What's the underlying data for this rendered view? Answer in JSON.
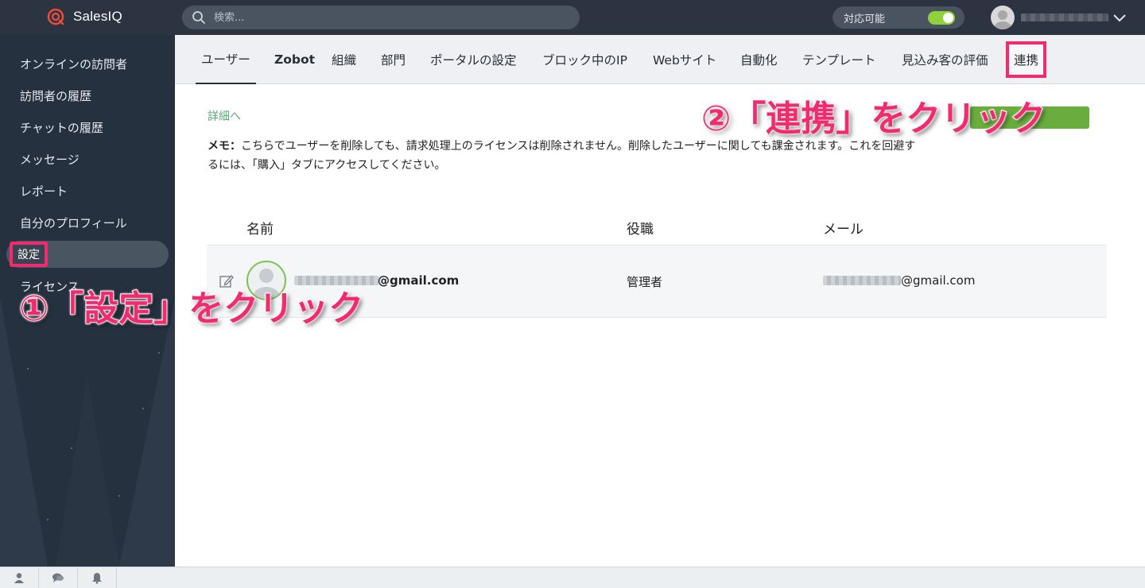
{
  "app": {
    "name": "SalesIQ"
  },
  "search": {
    "placeholder": "検索..."
  },
  "status": {
    "label": "対応可能",
    "toggle_on": true,
    "toggle_color": "#8fd23a"
  },
  "sidebar": {
    "items": [
      {
        "label": "オンラインの訪問者"
      },
      {
        "label": "訪問者の履歴"
      },
      {
        "label": "チャットの履歴"
      },
      {
        "label": "メッセージ"
      },
      {
        "label": "レポート"
      },
      {
        "label": "自分のプロフィール"
      },
      {
        "label": "設定",
        "active": true
      },
      {
        "label": "ライセンス"
      }
    ]
  },
  "tabs": [
    {
      "label": "ユーザー",
      "selected": true
    },
    {
      "label": "Zobot"
    },
    {
      "label": "組織"
    },
    {
      "label": "部門"
    },
    {
      "label": "ポータルの設定"
    },
    {
      "label": "ブロック中のIP"
    },
    {
      "label": "Webサイト"
    },
    {
      "label": "自動化"
    },
    {
      "label": "テンプレート"
    },
    {
      "label": "見込み客の評価"
    },
    {
      "label": "連携",
      "highlighted": true
    }
  ],
  "main": {
    "detail_link": "詳細へ",
    "memo_label": "メモ：",
    "memo_text": "こちらでユーザーを削除しても、請求処理上のライセンスは削除されません。削除したユーザーに関しても課金されます。これを回避するには、「購入」タブにアクセスしてください。"
  },
  "table": {
    "headers": {
      "name": "名前",
      "role": "役職",
      "email": "メール"
    },
    "rows": [
      {
        "name": "@gmail.com",
        "role": "管理者",
        "email": "@gmail.com"
      }
    ]
  },
  "annotations": {
    "step1": "①「設定」をクリック",
    "step2": "②「連携」をクリック",
    "color": "#f22b6e"
  },
  "icons": [
    "salesiq-logo-icon",
    "search-icon",
    "chevron-down-icon",
    "edit-icon",
    "user-icon",
    "chat-icon",
    "bell-icon"
  ]
}
